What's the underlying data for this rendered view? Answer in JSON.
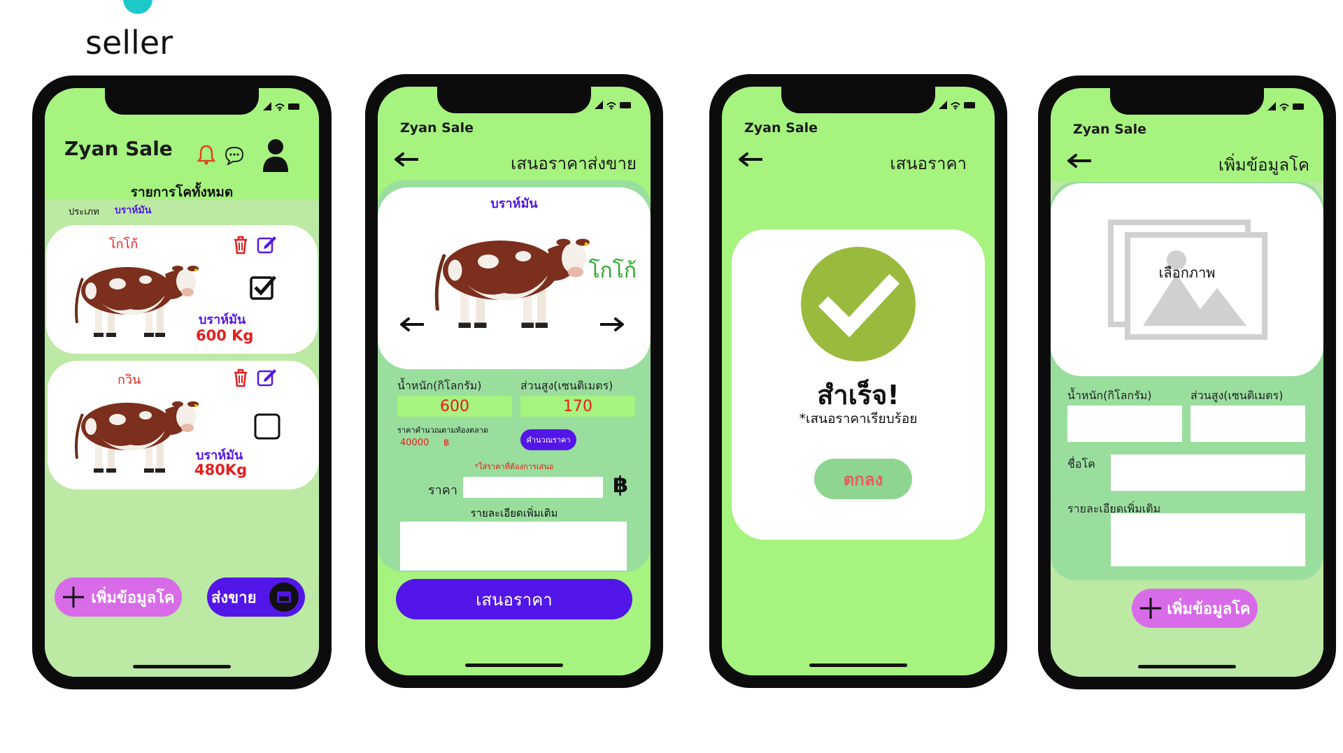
{
  "seller_label": "seller",
  "colors": {
    "phone_green": "#a6f37f",
    "panel_green": "#9ade9e",
    "purple": "#5316e8",
    "pink": "#d86ce8",
    "red": "#e51d1d",
    "success_green": "#9aba3e"
  },
  "screen1": {
    "app_title": "Zyan Sale",
    "list_heading": "รายการโคทั้งหมด",
    "type_label": "ประเภท",
    "type_value": "บราห์มัน",
    "cards": [
      {
        "name": "โกโก้",
        "breed": "บราห์มัน",
        "weight": "600 Kg",
        "checked": true
      },
      {
        "name": "กวิน",
        "breed": "บราห์มัน",
        "weight": "480Kg",
        "checked": false
      }
    ],
    "add_button": "เพิ่มข้อมูลโค",
    "sell_button": "ส่งขาย"
  },
  "screen2": {
    "app_title": "Zyan Sale",
    "title": "เสนอราคาส่งขาย",
    "breed": "บราห์มัน",
    "cow_name": "โกโก้",
    "weight_label": "น้ำหนัก(กิโลกรัม)",
    "height_label": "ส่วนสูง(เซนติเมตร)",
    "weight_value": "600",
    "height_value": "170",
    "calc_label": "ราคาคำนวณตามท้องตลาด",
    "calc_value": "40000",
    "currency_small": "฿",
    "calc_button": "คำนวณราคา",
    "hint": "*ใส่ราคาที่ต้องการเสนอ",
    "price_label": "ราคา",
    "price_value": "",
    "currency": "฿",
    "details_label": "รายละเอียดเพิ่มเติม",
    "details_value": "",
    "submit_button": "เสนอราคา"
  },
  "screen3": {
    "app_title": "Zyan Sale",
    "title": "เสนอราคา",
    "success_title": "สำเร็จ!",
    "success_sub": "*เสนอราคาเรียบร้อย",
    "ok_button": "ตกลง"
  },
  "screen4": {
    "app_title": "Zyan Sale",
    "title": "เพิ่มข้อมูลโค",
    "choose_image": "เลือกภาพ",
    "weight_label": "น้ำหนัก(กิโลกรัม)",
    "height_label": "ส่วนสูง(เซนติเมตร)",
    "name_label": "ชื่อโค",
    "details_label": "รายละเอียดเพิ่มเติม",
    "add_button": "เพิ่มข้อมูลโค"
  }
}
